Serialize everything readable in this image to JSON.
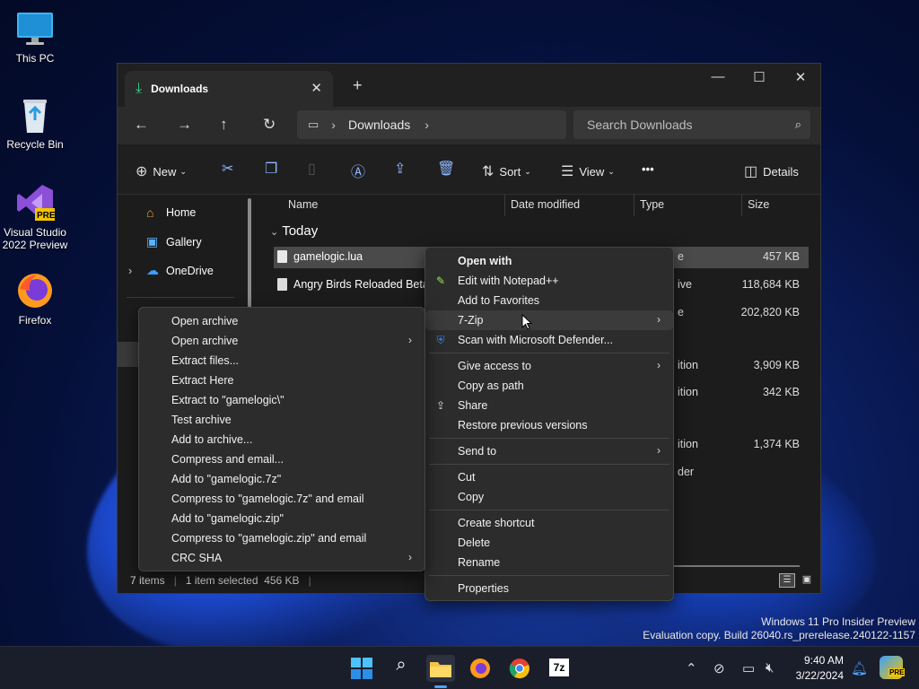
{
  "desktop": {
    "icons": [
      {
        "label": "This PC"
      },
      {
        "label": "Recycle Bin"
      },
      {
        "label": "Visual Studio 2022 Preview",
        "badge": "PRE"
      },
      {
        "label": "Firefox"
      }
    ]
  },
  "window": {
    "tab_title": "Downloads",
    "address": {
      "segment": "Downloads"
    },
    "search_placeholder": "Search Downloads",
    "toolbar": {
      "new_label": "New",
      "sort_label": "Sort",
      "view_label": "View",
      "more_label": "•••",
      "details_label": "Details"
    },
    "sidebar": {
      "items": [
        {
          "label": "Home"
        },
        {
          "label": "Gallery"
        },
        {
          "label": "OneDrive"
        }
      ]
    },
    "columns": {
      "name": "Name",
      "date": "Date modified",
      "type": "Type",
      "size": "Size"
    },
    "group_label": "Today",
    "files": [
      {
        "name": "gamelogic.lua",
        "type": "e",
        "size": "457 KB"
      },
      {
        "name": "Angry Birds Reloaded Beta 4",
        "type": "ive",
        "size": "118,684 KB"
      },
      {
        "name": "",
        "type": "e",
        "size": "202,820 KB"
      },
      {
        "name": "",
        "type": "ition",
        "size": "3,909 KB"
      },
      {
        "name": "",
        "type": "ition",
        "size": "342 KB"
      },
      {
        "name": "",
        "type": "ition",
        "size": "1,374 KB"
      },
      {
        "name": "",
        "type": "der",
        "size": ""
      }
    ],
    "status": {
      "items": "7 items",
      "selected": "1 item selected  456 KB"
    }
  },
  "context_menu": {
    "items": [
      {
        "label": "Open with",
        "bold": true
      },
      {
        "label": "Edit with Notepad++",
        "icon": "notepad-plus-plus-icon"
      },
      {
        "label": "Add to Favorites"
      },
      {
        "label": "7-Zip",
        "submenu": true,
        "highlighted": true
      },
      {
        "label": "Scan with Microsoft Defender...",
        "icon": "defender-shield-icon"
      },
      {
        "label": "Give access to",
        "submenu": true
      },
      {
        "label": "Copy as path"
      },
      {
        "label": "Share",
        "icon": "share-icon"
      },
      {
        "label": "Restore previous versions"
      },
      {
        "label": "Send to",
        "submenu": true
      },
      {
        "label": "Cut"
      },
      {
        "label": "Copy"
      },
      {
        "label": "Create shortcut"
      },
      {
        "label": "Delete"
      },
      {
        "label": "Rename"
      },
      {
        "label": "Properties"
      }
    ]
  },
  "zip_submenu": {
    "items": [
      {
        "label": "Open archive"
      },
      {
        "label": "Open archive",
        "submenu": true
      },
      {
        "label": "Extract files..."
      },
      {
        "label": "Extract Here"
      },
      {
        "label": "Extract to \"gamelogic\\\""
      },
      {
        "label": "Test archive"
      },
      {
        "label": "Add to archive..."
      },
      {
        "label": "Compress and email..."
      },
      {
        "label": "Add to \"gamelogic.7z\""
      },
      {
        "label": "Compress to \"gamelogic.7z\" and email"
      },
      {
        "label": "Add to \"gamelogic.zip\""
      },
      {
        "label": "Compress to \"gamelogic.zip\" and email"
      },
      {
        "label": "CRC SHA",
        "submenu": true
      }
    ]
  },
  "watermark": {
    "line1": "Windows 11 Pro Insider Preview",
    "line2": "Evaluation copy. Build 26040.rs_prerelease.240122-1157"
  },
  "taskbar": {
    "time": "9:40 AM",
    "date": "3/22/2024",
    "apps": [
      "start-icon",
      "search-icon",
      "file-explorer-icon",
      "firefox-icon",
      "chrome-icon",
      "7zip-icon"
    ],
    "copilot_badge": "PRE"
  },
  "colors": {
    "accent": "#4aa3ff",
    "folder": "#f5c542",
    "selection": "#4a4a4a"
  }
}
